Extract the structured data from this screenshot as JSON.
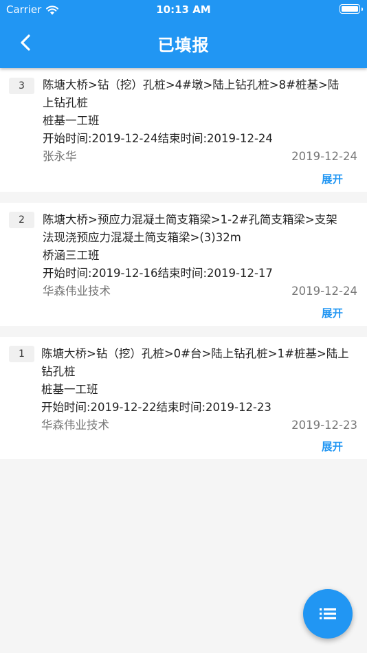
{
  "status_bar": {
    "carrier": "Carrier",
    "time": "10:13 AM"
  },
  "appbar": {
    "title": "已填报"
  },
  "records": [
    {
      "index": "3",
      "lines": [
        "陈塘大桥>钻（挖）孔桩>4#墩>陆上钻孔桩>8#桩基>陆",
        "上钻孔桩",
        "桩基一工班",
        "开始时间:2019-12-24结束时间:2019-12-24"
      ],
      "author": "张永华",
      "date": "2019-12-24",
      "expand_label": "展开"
    },
    {
      "index": "2",
      "lines": [
        "陈塘大桥>预应力混凝土简支箱梁>1-2#孔简支箱梁>支架",
        "法现浇预应力混凝土简支箱梁>(3)32m",
        "桥涵三工班",
        "开始时间:2019-12-16结束时间:2019-12-17"
      ],
      "author": "华森伟业技术",
      "date": "2019-12-24",
      "expand_label": "展开"
    },
    {
      "index": "1",
      "lines": [
        "陈塘大桥>钻（挖）孔桩>0#台>陆上钻孔桩>1#桩基>陆上",
        "钻孔桩",
        "桩基一工班",
        "开始时间:2019-12-22结束时间:2019-12-23"
      ],
      "author": "华森伟业技术",
      "date": "2019-12-23",
      "expand_label": "展开"
    }
  ],
  "colors": {
    "primary": "#2196f3",
    "background": "#f5f5f5"
  },
  "icons": {
    "back": "chevron-left-icon",
    "wifi": "wifi-icon",
    "battery": "battery-icon",
    "fab": "list-icon"
  }
}
